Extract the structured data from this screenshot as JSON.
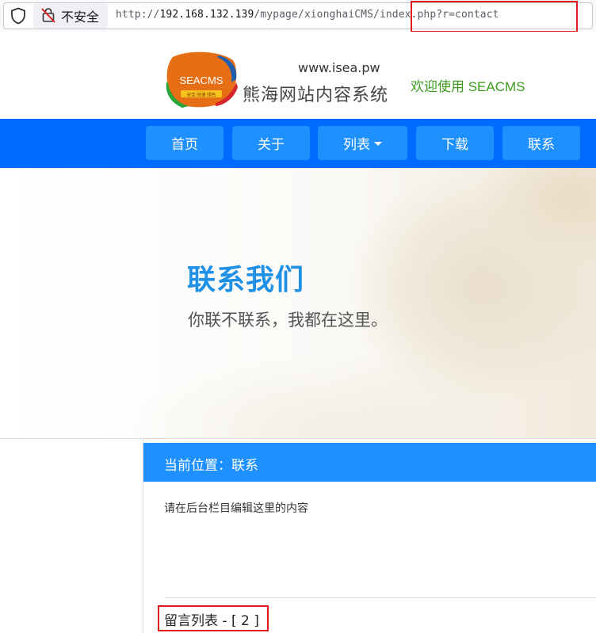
{
  "browser": {
    "security_label": "不安全",
    "url_prefix": "http://",
    "url_host": "192.168.132.139",
    "url_path": "/mypage/xionghaiCMS/index.php?r=contact",
    "highlight_color": "#e0191e"
  },
  "header": {
    "logo_text": "SEACMS",
    "logo_tagline": "安全·快速·绿色",
    "logo_url": "www.isea.pw",
    "logo_name": "熊海网站内容系统",
    "welcome": "欢迎使用 SEACMS"
  },
  "nav": {
    "items": [
      {
        "label": "首页"
      },
      {
        "label": "关于"
      },
      {
        "label": "列表",
        "has_dropdown": true
      },
      {
        "label": "下载"
      },
      {
        "label": "联系"
      }
    ],
    "bar_color": "#006cff",
    "button_color": "#1e90ff"
  },
  "hero": {
    "title": "联系我们",
    "subtitle": "你联不联系，我都在这里。"
  },
  "content": {
    "breadcrumb": "当前位置：联系",
    "body_text": "请在后台栏目编辑这里的内容",
    "messages_title": "留言列表 - [ 2 ]"
  },
  "icons": {
    "shield": "shield-icon",
    "lock": "insecure-lock-icon",
    "caret": "caret-down-icon"
  }
}
